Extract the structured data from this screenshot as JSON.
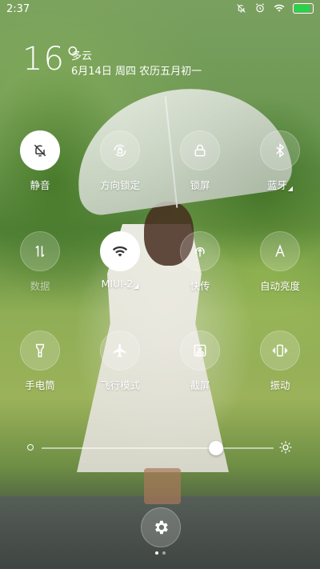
{
  "status_bar": {
    "time": "2:37",
    "icons": [
      "mute-icon",
      "alarm-icon",
      "wifi-icon",
      "battery-icon"
    ],
    "battery_level": 1.0,
    "battery_color": "#27d34a"
  },
  "weather": {
    "temperature": "16°",
    "condition": "多云",
    "date": "6月14日 周四 农历五月初一"
  },
  "toggles": [
    {
      "label": "静音",
      "icon": "bell-off-icon",
      "active": true,
      "dim": false,
      "expand": false
    },
    {
      "label": "方向锁定",
      "icon": "rotation-lock-icon",
      "active": false,
      "dim": false,
      "expand": false
    },
    {
      "label": "锁屏",
      "icon": "lock-icon",
      "active": false,
      "dim": false,
      "expand": false
    },
    {
      "label": "蓝牙",
      "icon": "bluetooth-icon",
      "active": false,
      "dim": false,
      "expand": true
    },
    {
      "label": "数据",
      "icon": "data-icon",
      "active": false,
      "dim": true,
      "expand": false
    },
    {
      "label": "MIUI-2",
      "icon": "wifi-icon",
      "active": true,
      "dim": false,
      "expand": true
    },
    {
      "label": "快传",
      "icon": "quick-transfer-icon",
      "active": false,
      "dim": false,
      "expand": false
    },
    {
      "label": "自动亮度",
      "icon": "auto-brightness-icon",
      "active": false,
      "dim": false,
      "expand": false
    },
    {
      "label": "手电筒",
      "icon": "flashlight-icon",
      "active": false,
      "dim": false,
      "expand": false
    },
    {
      "label": "飞行模式",
      "icon": "airplane-icon",
      "active": false,
      "dim": false,
      "expand": false
    },
    {
      "label": "截屏",
      "icon": "screenshot-icon",
      "active": false,
      "dim": false,
      "expand": false
    },
    {
      "label": "振动",
      "icon": "vibrate-icon",
      "active": false,
      "dim": false,
      "expand": false
    }
  ],
  "brightness": {
    "level": 0.75
  },
  "pager": {
    "pages": 2,
    "current": 1
  }
}
